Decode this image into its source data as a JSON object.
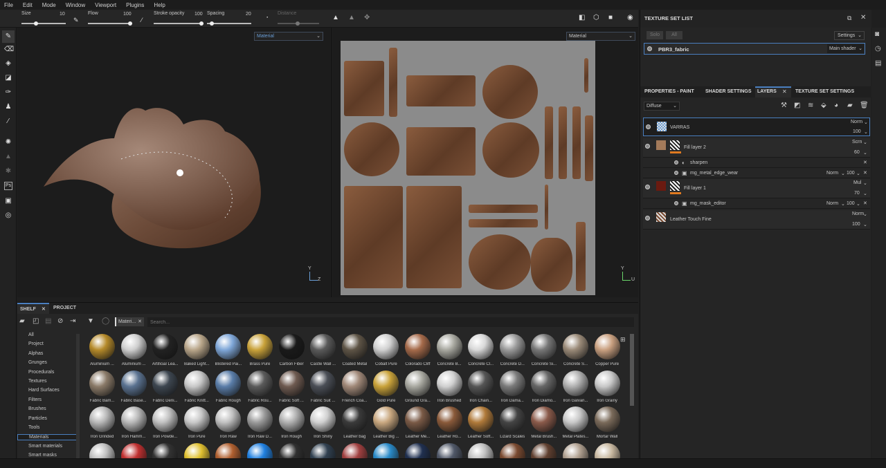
{
  "menu": [
    "File",
    "Edit",
    "Mode",
    "Window",
    "Viewport",
    "Plugins",
    "Help"
  ],
  "toolbar": {
    "size_label": "Size",
    "size_value": "10",
    "flow_label": "Flow",
    "flow_value": "100",
    "stroke_label": "Stroke opacity",
    "stroke_value": "100",
    "spacing_label": "Spacing",
    "spacing_value": "20",
    "distance_label": "Distance"
  },
  "viewport3d": {
    "mode": "Material",
    "axis_y": "Y",
    "axis_z": "Z"
  },
  "viewport2d": {
    "mode": "Material",
    "axis_y": "Y",
    "axis_u": "U"
  },
  "texture_set_list": {
    "title": "TEXTURE SET LIST",
    "solo": "Solo",
    "all": "All",
    "settings": "Settings",
    "set_name": "PBR3_fabric",
    "shader": "Main shader"
  },
  "tabs": [
    "PROPERTIES - PAINT",
    "SHADER SETTINGS",
    "LAYERS",
    "TEXTURE SET SETTINGS"
  ],
  "channel": "Diffuse",
  "layers": [
    {
      "name": "VARRAS",
      "blend": "Norm",
      "opacity": "100"
    },
    {
      "name": "Fill layer 2",
      "blend": "Scrn",
      "opacity": "60"
    },
    {
      "name": "sharpen"
    },
    {
      "name": "mg_metal_edge_wear",
      "blend": "Norm",
      "opacity": "100"
    },
    {
      "name": "Fill layer 1",
      "blend": "Mul",
      "opacity": "70"
    },
    {
      "name": "mg_mask_editor",
      "blend": "Norm",
      "opacity": "100"
    },
    {
      "name": "Leather Touch Fine",
      "blend": "Norm",
      "opacity": "100"
    }
  ],
  "shelf": {
    "tab_shelf": "SHELF",
    "tab_project": "PROJECT",
    "filter_chip": "Materi...",
    "search_placeholder": "Search...",
    "categories": [
      "All",
      "Project",
      "Alphas",
      "Grunges",
      "Procedurals",
      "Textures",
      "Hard Surfaces",
      "Filters",
      "Brushes",
      "Particles",
      "Tools",
      "Materials",
      "Smart materials",
      "Smart masks"
    ],
    "selected_category": "Materials",
    "materials": [
      "Aluminium ...",
      "Aluminium ...",
      "Artificial Lea...",
      "Baked Light...",
      "Blistered Pai...",
      "Brass Pure",
      "Carbon Fiber",
      "Castle Wall ...",
      "Coated Metal",
      "Cobalt Pure",
      "Colorado Cliff",
      "Concrete B...",
      "Concrete Cl...",
      "Concrete D...",
      "Concrete Si...",
      "Concrete S...",
      "Copper Pure",
      "Fabric Bam...",
      "Fabric Base...",
      "Fabric Deni...",
      "Fabric Knitt...",
      "Fabric Rough",
      "Fabric Rou...",
      "Fabric Soft ...",
      "Fabric Suit ...",
      "French Coa...",
      "Gold Pure",
      "Ground Gra...",
      "Iron Brushed",
      "Iron Chain...",
      "Iron Dama...",
      "Iron Diamo...",
      "Iron Galvan...",
      "Iron Grainy",
      "Iron Grinded",
      "Iron Hamm...",
      "Iron Powde...",
      "Iron Pure",
      "Iron Raw",
      "Iron Raw D...",
      "Iron Rough",
      "Iron Shiny",
      "Leather bag",
      "Leather Big ...",
      "Leather Me...",
      "Leather Ro...",
      "Leather Soft...",
      "Lizard Scales",
      "Metal Brush...",
      "Metal Plates...",
      "Mortar Wall",
      "",
      "",
      "",
      "",
      "",
      "",
      "",
      "",
      "",
      "",
      "",
      "",
      "",
      "",
      "",
      "",
      ""
    ]
  }
}
